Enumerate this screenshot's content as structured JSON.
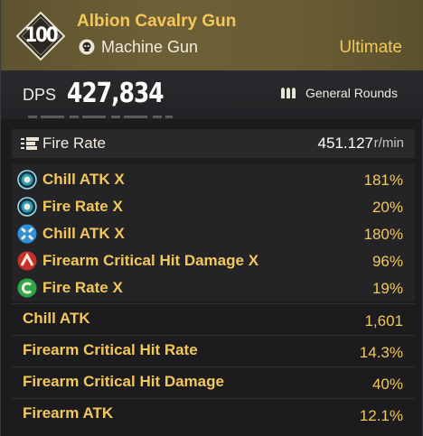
{
  "weapon": {
    "level": "100",
    "name": "Albion Cavalry Gun",
    "type": "Machine Gun",
    "type_icon": "skull-icon",
    "rarity": "Ultimate"
  },
  "dps": {
    "label": "DPS",
    "value": "427,834",
    "ammo_label": "General Rounds",
    "ammo_icon": "bullets-icon"
  },
  "fire_rate": {
    "label": "Fire Rate",
    "value": "451.127",
    "unit": "r/min"
  },
  "modules": [
    {
      "label": "Chill ATK X",
      "value": "181%",
      "icon": "chill-icon",
      "color": "#2a9db8"
    },
    {
      "label": "Fire Rate X",
      "value": "20%",
      "icon": "fire-rate-icon",
      "color": "#2a9db8"
    },
    {
      "label": "Chill ATK X",
      "value": "180%",
      "icon": "chill-cross-icon",
      "color": "#2f8fd8"
    },
    {
      "label": "Firearm Critical Hit Damage X",
      "value": "96%",
      "icon": "firearm-icon",
      "color": "#c8302c"
    },
    {
      "label": "Fire Rate X",
      "value": "19%",
      "icon": "c-icon",
      "color": "#2ea64a"
    }
  ],
  "stats": [
    {
      "label": "Chill ATK",
      "value": "1,601"
    },
    {
      "label": "Firearm Critical Hit Rate",
      "value": "14.3%"
    },
    {
      "label": "Firearm Critical Hit Damage",
      "value": "40%"
    },
    {
      "label": "Firearm ATK",
      "value": "12.1%"
    }
  ],
  "colors": {
    "accent_gold": "#f3c75a",
    "header_bg": "#6a5d35",
    "panel_bg": "#1c1c1f"
  }
}
